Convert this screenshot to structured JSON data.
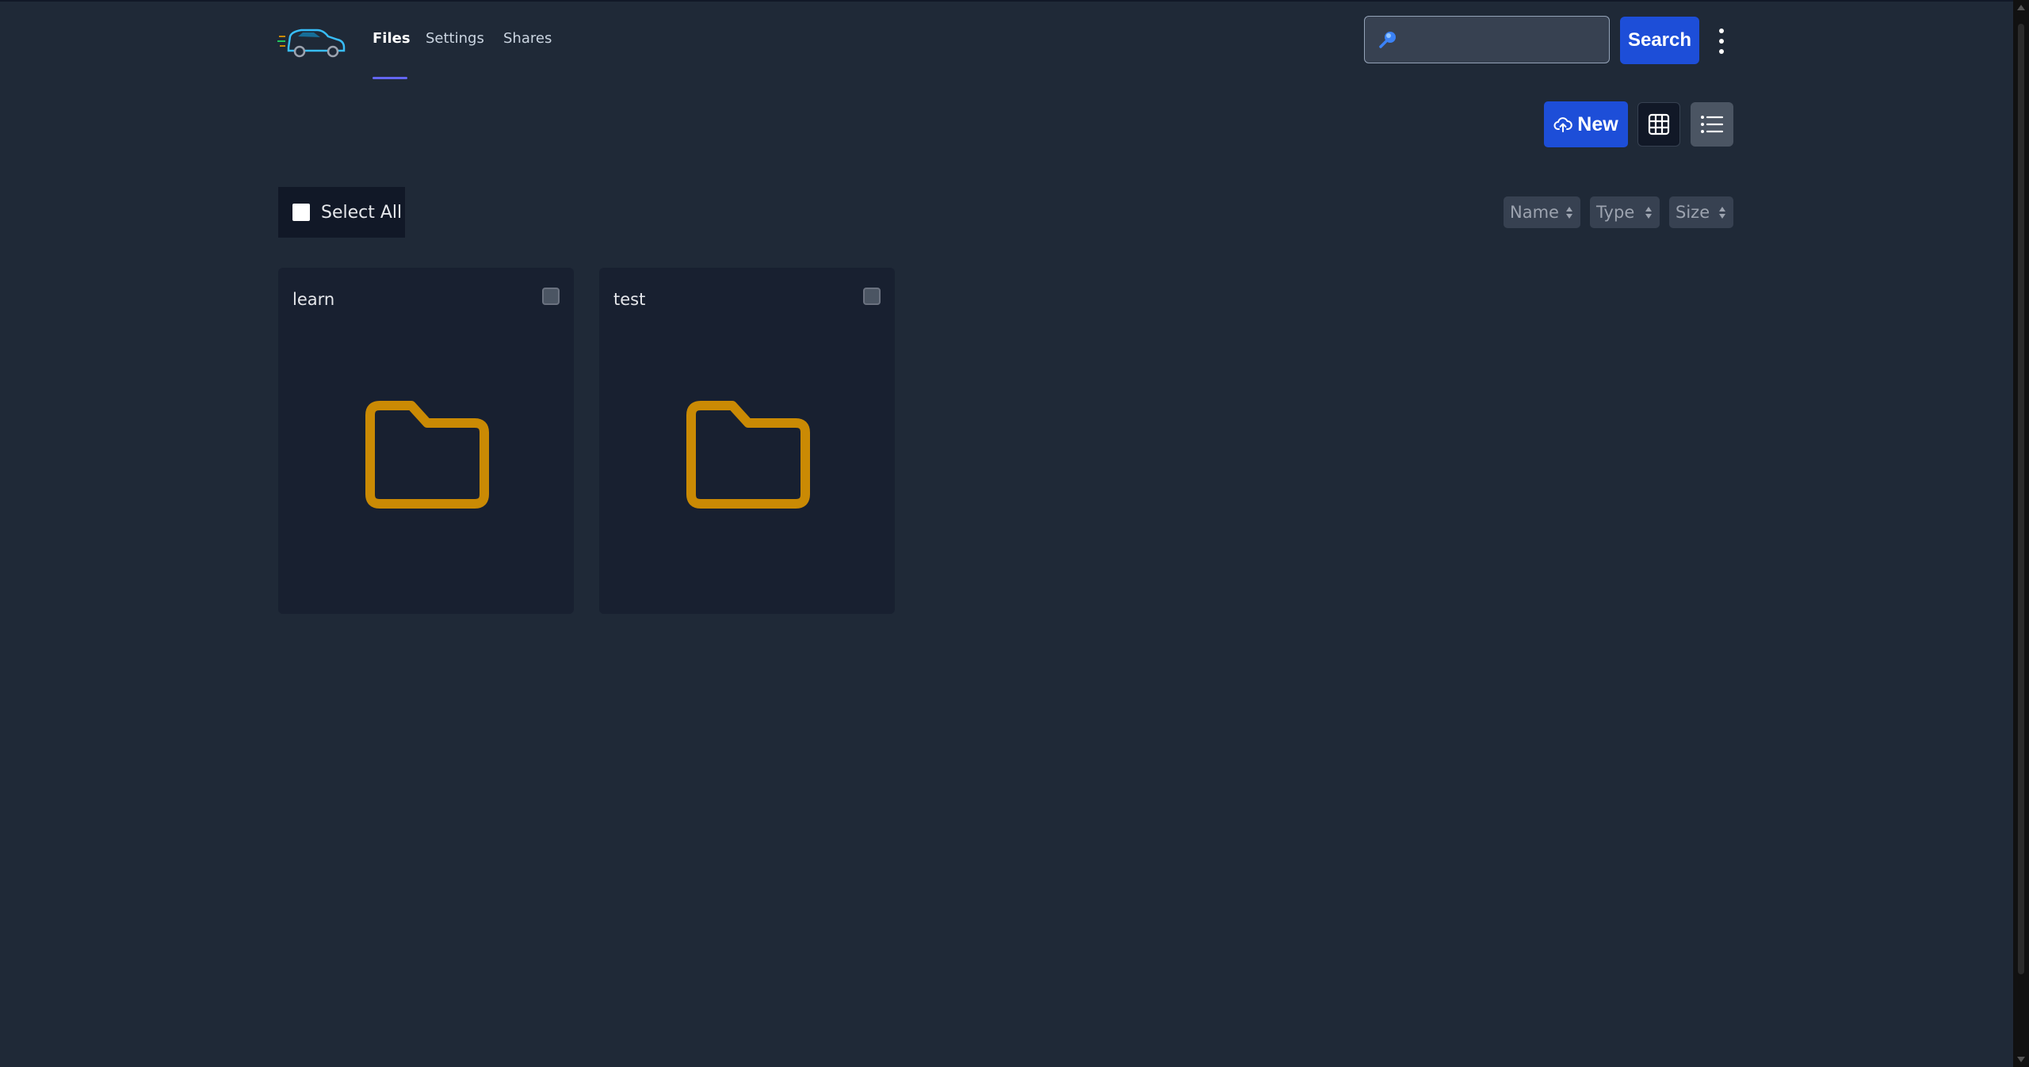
{
  "header": {
    "nav": [
      {
        "label": "Files",
        "active": true
      },
      {
        "label": "Settings",
        "active": false
      },
      {
        "label": "Shares",
        "active": false
      }
    ],
    "search": {
      "placeholder": "",
      "value": "",
      "button_label": "Search"
    }
  },
  "toolbar": {
    "new_label": "New",
    "view_modes": [
      "grid-icon",
      "list-icon"
    ]
  },
  "selection": {
    "select_all_label": "Select All"
  },
  "sort": [
    {
      "label": "Name"
    },
    {
      "label": "Type"
    },
    {
      "label": "Size"
    }
  ],
  "folders": [
    {
      "name": "learn",
      "icon": "folder-icon"
    },
    {
      "name": "test",
      "icon": "folder-icon"
    }
  ],
  "colors": {
    "background": "#1f2937",
    "card": "#182030",
    "accent_blue": "#1d4ed8",
    "folder": "#ca8a04",
    "tab_underline": "#6366f1"
  }
}
